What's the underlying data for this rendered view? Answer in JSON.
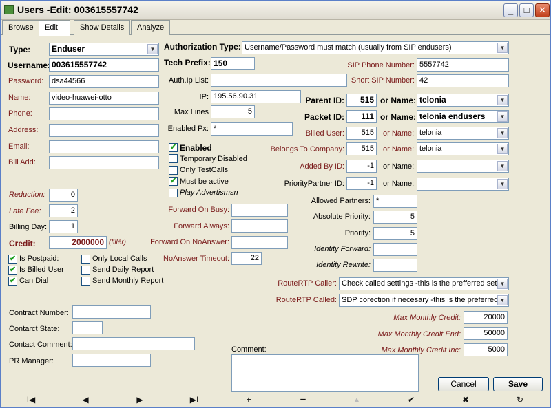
{
  "window": {
    "title": "Users -Edit: 003615557742",
    "controls": {
      "minimize": "_",
      "maximize": "□",
      "close": "✕"
    }
  },
  "tabs": [
    "Browse",
    "Edit",
    "Show Details",
    "Analyze"
  ],
  "left": {
    "type_label": "Type:",
    "type_value": "Enduser",
    "username_label": "Username:",
    "username_value": "003615557742",
    "password_label": "Password:",
    "password_value": "dsa44566",
    "name_label": "Name:",
    "name_value": "video-huawei-otto",
    "phone_label": "Phone:",
    "phone_value": "",
    "address_label": "Address:",
    "address_value": "",
    "email_label": "Email:",
    "email_value": "",
    "billadd_label": "Bill Add:",
    "billadd_value": "",
    "reduction_label": "Reduction:",
    "reduction_value": "0",
    "latefee_label": "Late Fee:",
    "latefee_value": "2",
    "billingday_label": "Billing Day:",
    "billingday_value": "1",
    "credit_label": "Credit:",
    "credit_value": "2000000",
    "credit_unit": "(fillér)",
    "checks": [
      {
        "label": "Is Postpaid:",
        "checked": true
      },
      {
        "label": "Is Billed User",
        "checked": true
      },
      {
        "label": "Can Dial",
        "checked": true
      },
      {
        "label": "Only Local Calls",
        "checked": false
      },
      {
        "label": "Send Daily Report",
        "checked": false
      },
      {
        "label": "Send Monthly Report",
        "checked": false
      }
    ],
    "contract_number_label": "Contract Number:",
    "contract_number_value": "",
    "contract_state_label": "Contarct State:",
    "contract_state_value": "",
    "contact_comment_label": "Contact Comment:",
    "contact_comment_value": "",
    "pr_manager_label": "PR Manager:",
    "pr_manager_value": ""
  },
  "middle": {
    "auth_type_label": "Authorization Type:",
    "auth_type_value": "Username/Password must match (usually from SIP endusers)",
    "tech_prefix_label": "Tech Prefix:",
    "tech_prefix_value": "150",
    "auth_ip_list_label": "Auth.Ip List:",
    "auth_ip_list_value": "",
    "ip_label": "IP:",
    "ip_value": "195.56.90.31",
    "max_lines_label": "Max Lines",
    "max_lines_value": "5",
    "enabled_px_label": "Enabled Px:",
    "enabled_px_value": "*",
    "checks": [
      {
        "label": "Enabled",
        "checked": true
      },
      {
        "label": "Temporary Disabled",
        "checked": false
      },
      {
        "label": "Only TestCalls",
        "checked": false
      },
      {
        "label": "Must be active",
        "checked": true
      },
      {
        "label": "Play Advertismsn",
        "checked": false
      }
    ],
    "fwd_busy_label": "Forward On Busy:",
    "fwd_busy_value": "",
    "fwd_always_label": "Forward Always:",
    "fwd_always_value": "",
    "fwd_noanswer_label": "Forward On NoAnswer:",
    "fwd_noanswer_value": "",
    "noanswer_timeout_label": "NoAnswer Timeout:",
    "noanswer_timeout_value": "22",
    "comment_label": "Comment:",
    "comment_value": ""
  },
  "right": {
    "sip_phone_label": "SIP Phone Number:",
    "sip_phone_value": "5557742",
    "short_sip_label": "Short SIP Number:",
    "short_sip_value": "42",
    "parent_id_label": "Parent ID:",
    "parent_id_value": "515",
    "parent_or": "or Name:",
    "parent_name": "telonia",
    "packet_id_label": "Packet ID:",
    "packet_id_value": "111",
    "packet_or": "or Name:",
    "packet_name": "telonia endusers",
    "billed_user_label": "Billed User:",
    "billed_user_value": "515",
    "billed_or": "or Name:",
    "billed_name": "telonia",
    "belongs_label": "Belongs To Company:",
    "belongs_value": "515",
    "belongs_or": "or Name:",
    "belongs_name": "telonia",
    "added_by_label": "Added By ID:",
    "added_by_value": "-1",
    "added_or": "or Name:",
    "added_name": "",
    "priority_partner_label": "PriorityPartner ID:",
    "priority_partner_value": "-1",
    "priority_or": "or Name:",
    "priority_name": "",
    "allowed_partners_label": "Allowed Partners:",
    "allowed_partners_value": "*",
    "abs_priority_label": "Absolute Priority:",
    "abs_priority_value": "5",
    "priority_label": "Priority:",
    "priority_value": "5",
    "identity_forward_label": "Identity Forward:",
    "identity_forward_value": "",
    "identity_rewrite_label": "Identity Rewrite:",
    "identity_rewrite_value": "",
    "route_caller_label": "RouteRTP Caller:",
    "route_caller_value": "Check called settings -this is the prefferred settin",
    "route_called_label": "RouteRTP Called:",
    "route_called_value": "SDP corection if necesary  -this is the preferred",
    "max_monthly_credit_label": "Max Monthly Credit:",
    "max_monthly_credit_value": "20000",
    "max_monthly_credit_end_label": "Max Monthly Credit End:",
    "max_monthly_credit_end_value": "50000",
    "max_monthly_credit_inc_label": "Max Monthly Credit Inc:",
    "max_monthly_credit_inc_value": "5000",
    "cancel_label": "Cancel",
    "save_label": "Save"
  },
  "navbar": [
    "I◀",
    "◀",
    "▶",
    "▶I",
    "+",
    "━",
    "▲",
    "✔",
    "✖",
    "↻"
  ]
}
